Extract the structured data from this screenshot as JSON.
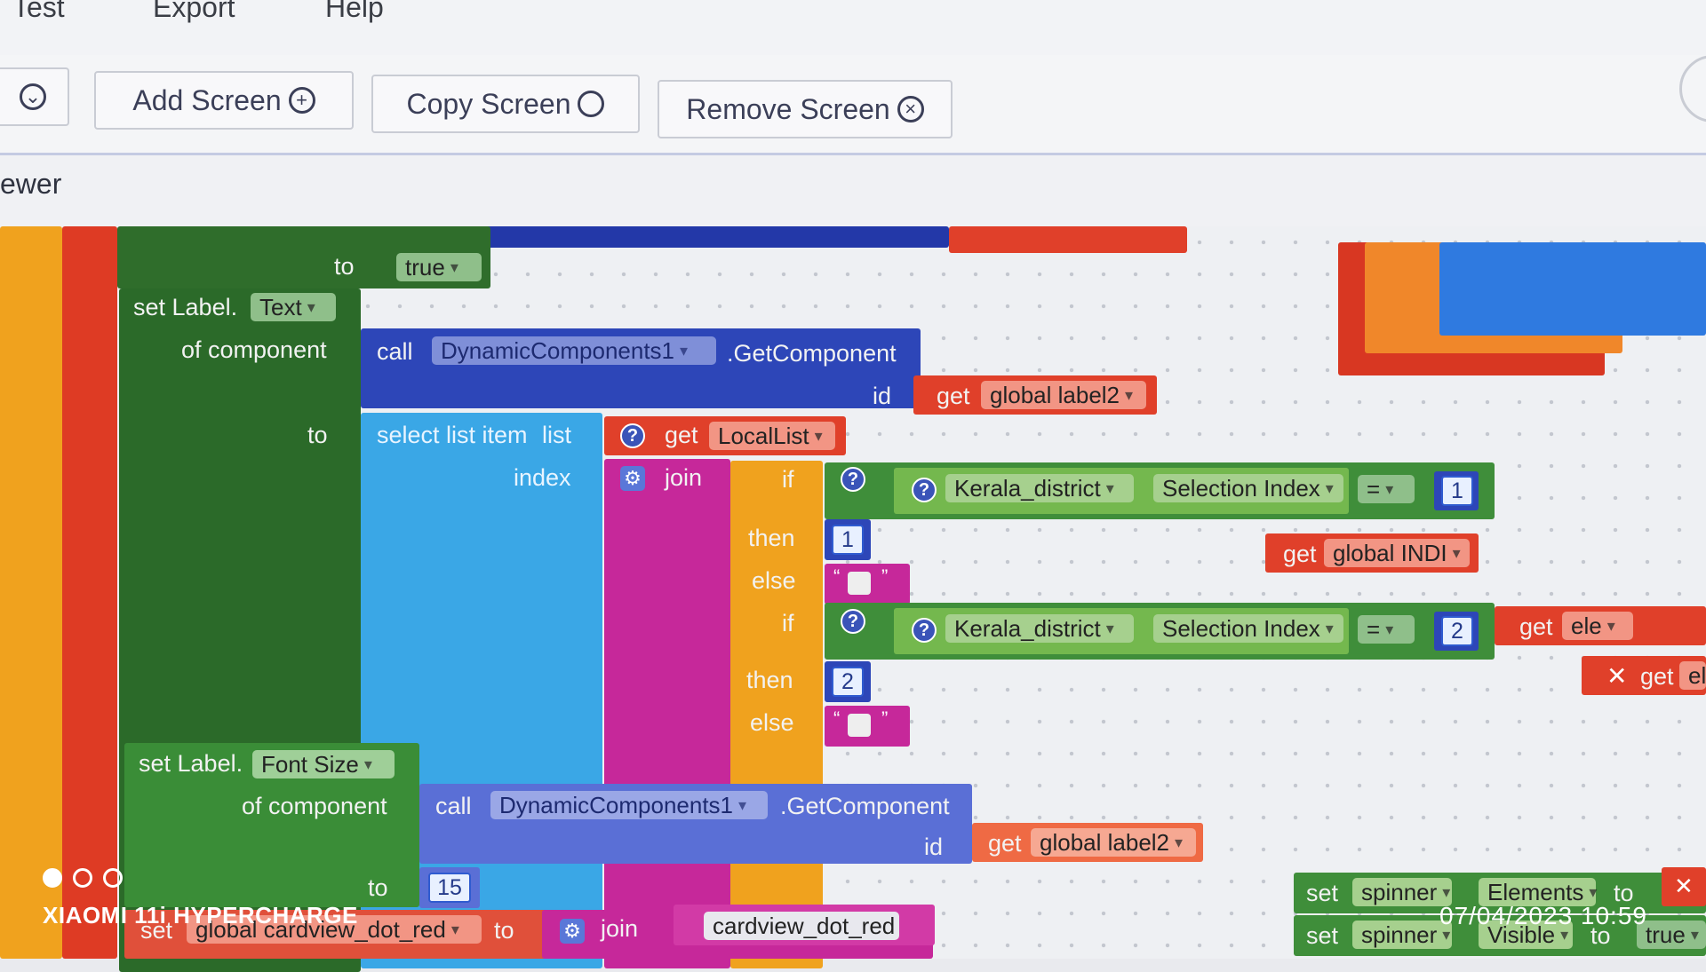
{
  "menu": {
    "items": [
      "Test",
      "Export",
      "Help"
    ]
  },
  "toolbar": {
    "add_screen": "Add Screen",
    "copy_screen": "Copy Screen",
    "remove_screen": "Remove Screen"
  },
  "viewer": {
    "label": "ewer"
  },
  "blocks": {
    "to": "to",
    "true_value": "true",
    "set_label": "set Label.",
    "text_prop": "Text",
    "of_component": "of component",
    "call": "call",
    "dynamic_components": "DynamicComponents1",
    "get_component": ".GetComponent",
    "id": "id",
    "get": "get",
    "global_label2": "global label2",
    "select_list_item": "select list item",
    "list": "list",
    "local_list": "LocalList",
    "index": "index",
    "join": "join",
    "if": "if",
    "then": "then",
    "else": "else",
    "kerala_district": "Kerala_district",
    "selection_index": "Selection Index",
    "equals": "=",
    "num1": "1",
    "num2": "2",
    "global_indi": "global INDI",
    "ele": "ele",
    "el": "el",
    "font_size_prop": "Font Size",
    "num15": "15",
    "set": "set",
    "global_cardview": "global cardview_dot_red",
    "cardview_dot_red": "cardview_dot_red",
    "spinner": "spinner",
    "elements": "Elements",
    "visible": "Visible",
    "true_partial": "true"
  },
  "overlay": {
    "brand": "XIAOMI 11i HYPERCHARGE",
    "timestamp": "07/04/2023  10:59"
  },
  "colors": {
    "green": "#2e6b2b",
    "dark_blue": "#2338a8",
    "light_blue": "#3aa7e6",
    "magenta": "#c6289a",
    "orange_if": "#f0a21e",
    "red_get": "#e0402a",
    "lime_event": "#3f8e3a"
  }
}
